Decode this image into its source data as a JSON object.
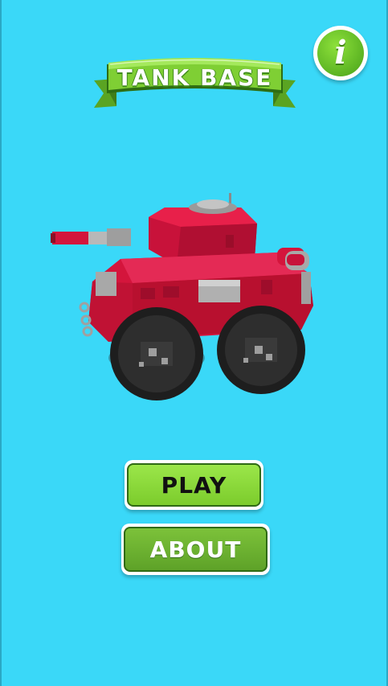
{
  "title": "TANK BASE",
  "info_button": {
    "icon": "info-icon",
    "label": "i"
  },
  "menu": {
    "play_label": "PLAY",
    "about_label": "ABOUT"
  },
  "colors": {
    "background": "#3ad8f8",
    "banner_green": "#7ccc2c",
    "tank_red": "#d4153c",
    "button_green": "#8fdc3c"
  }
}
